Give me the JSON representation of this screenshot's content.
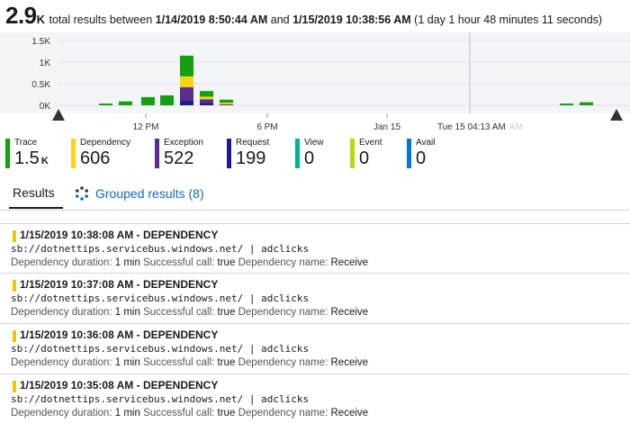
{
  "header": {
    "count": "2.9",
    "unit": "K",
    "text_pre": "total results between",
    "start": "1/14/2019 8:50:44 AM",
    "and": "and",
    "end": "1/15/2019 10:38:56 AM",
    "duration": "(1 day 1 hour 48 minutes 11 seconds)"
  },
  "chart_data": {
    "type": "bar",
    "stacked": true,
    "y_ticks": [
      "1.5K",
      "1K",
      "0.5K",
      "0K"
    ],
    "ylim": [
      0,
      1500
    ],
    "x_ticks": [
      "12 PM",
      "6 PM",
      "Jan 15"
    ],
    "hover_label": "Tue 15 04:13 AM",
    "hover_label_faded": "AM",
    "grid": true,
    "colors": {
      "trace": "#13a10e",
      "dependency": "#fcd116",
      "exception": "#5c2d91",
      "request": "#1c1c8c"
    },
    "bins": [
      {
        "trace": 40,
        "dependency": 0,
        "exception": 0,
        "request": 0
      },
      {
        "trace": 90,
        "dependency": 0,
        "exception": 0,
        "request": 0
      },
      {
        "trace": 190,
        "dependency": 0,
        "exception": 0,
        "request": 0
      },
      {
        "trace": 230,
        "dependency": 0,
        "exception": 0,
        "request": 0
      },
      {
        "trace": 480,
        "dependency": 250,
        "exception": 300,
        "request": 120
      },
      {
        "trace": 130,
        "dependency": 60,
        "exception": 80,
        "request": 60
      },
      {
        "trace": 70,
        "dependency": 40,
        "exception": 20,
        "request": 0
      },
      {
        "trace": 40,
        "dependency": 0,
        "exception": 0,
        "request": 0
      },
      {
        "trace": 70,
        "dependency": 0,
        "exception": 0,
        "request": 0
      }
    ]
  },
  "legend": [
    {
      "label": "Trace",
      "value": "1.5",
      "unit": "K",
      "color": "#13a10e"
    },
    {
      "label": "Dependency",
      "value": "606",
      "unit": "",
      "color": "#fcd116"
    },
    {
      "label": "Exception",
      "value": "522",
      "unit": "",
      "color": "#5c2d91"
    },
    {
      "label": "Request",
      "value": "199",
      "unit": "",
      "color": "#1c1c8c"
    },
    {
      "label": "View",
      "value": "0",
      "unit": "",
      "color": "#00b294"
    },
    {
      "label": "Event",
      "value": "0",
      "unit": "",
      "color": "#bad80a"
    },
    {
      "label": "Avail",
      "value": "0",
      "unit": "",
      "color": "#0078d4"
    }
  ],
  "tabs": {
    "results": "Results",
    "grouped": "Grouped results (8)"
  },
  "results": [
    {
      "title": "1/15/2019 10:38:08 AM - DEPENDENCY",
      "path": "sb://dotnettips.servicebus.windows.net/ | adclicks",
      "k1": "Dependency duration:",
      "v1": "1 min",
      "k2": "Successful call:",
      "v2": "true",
      "k3": "Dependency name:",
      "v3": "Receive"
    },
    {
      "title": "1/15/2019 10:37:08 AM - DEPENDENCY",
      "path": "sb://dotnettips.servicebus.windows.net/ | adclicks",
      "k1": "Dependency duration:",
      "v1": "1 min",
      "k2": "Successful call:",
      "v2": "true",
      "k3": "Dependency name:",
      "v3": "Receive"
    },
    {
      "title": "1/15/2019 10:36:08 AM - DEPENDENCY",
      "path": "sb://dotnettips.servicebus.windows.net/ | adclicks",
      "k1": "Dependency duration:",
      "v1": "1 min",
      "k2": "Successful call:",
      "v2": "true",
      "k3": "Dependency name:",
      "v3": "Receive"
    },
    {
      "title": "1/15/2019 10:35:08 AM - DEPENDENCY",
      "path": "sb://dotnettips.servicebus.windows.net/ | adclicks",
      "k1": "Dependency duration:",
      "v1": "1 min",
      "k2": "Successful call:",
      "v2": "true",
      "k3": "Dependency name:",
      "v3": "Receive"
    }
  ]
}
